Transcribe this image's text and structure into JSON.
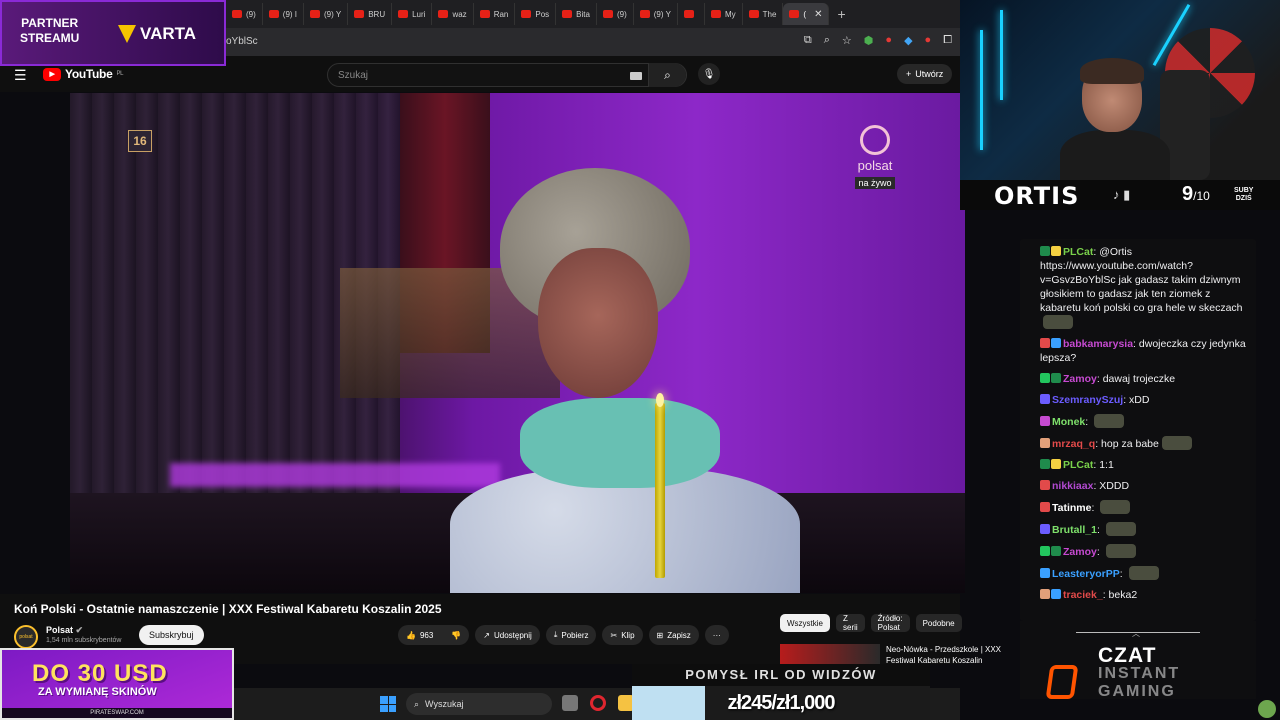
{
  "browser": {
    "tabs": [
      {
        "label": "(9)"
      },
      {
        "label": "(9) I"
      },
      {
        "label": "(9) Y"
      },
      {
        "label": "BRU"
      },
      {
        "label": "Luri"
      },
      {
        "label": "waz"
      },
      {
        "label": "Ran"
      },
      {
        "label": "Pos"
      },
      {
        "label": "Bita"
      },
      {
        "label": "(9)"
      },
      {
        "label": "(9) Y"
      },
      {
        "label": ""
      },
      {
        "label": "My"
      },
      {
        "label": "The"
      },
      {
        "label": "("
      }
    ],
    "url": "oYblSc"
  },
  "youtube": {
    "logo_text": "YouTube",
    "region": "PL",
    "search_placeholder": "Szukaj",
    "create_label": "Utwórz"
  },
  "video": {
    "age_rating": "16",
    "channel_logo": "polsat",
    "live_label": "na żywo",
    "title": "Koń Polski - Ostatnie namaszczenie | XXX Festiwal Kabaretu Koszalin 2025",
    "channel": "Polsat",
    "channel_avatar_text": "polsat",
    "subscribers": "1,54 mln subskrybentów",
    "subscribe_label": "Subskrybuj",
    "likes": "963",
    "share_label": "Udostępnij",
    "download_label": "Pobierz",
    "clip_label": "Klip",
    "save_label": "Zapisz",
    "more_label": "···"
  },
  "sidebar": {
    "chips": [
      "Wszystkie",
      "Z serii",
      "Źródło: Polsat",
      "Podobne"
    ],
    "rec_title": "Neo-Nówka - Przedszkole | XXX Festiwal Kabaretu Koszalin"
  },
  "overlays": {
    "partner_label": "PARTNER\nSTREAMU",
    "sponsor": "VARTA",
    "promo_big": "DO 30 USD",
    "promo_small": "ZA WYMIANĘ SKINÓW",
    "promo_site": "PIRATESWAP.COM",
    "streamer_name": "ORTIS",
    "subs_today": "9",
    "subs_goal": "/10",
    "subs_label": "SUBY\nDZIŚ",
    "pomysl": "POMYSŁ IRL OD WIDZÓW",
    "donation_goal": "zł245/zł1,000",
    "donation_progress": 0.245,
    "czat": "CZAT",
    "instant_gaming": "INSTANT\nGAMING"
  },
  "taskbar": {
    "search_label": "Wyszukaj"
  },
  "chat": [
    {
      "user": "PLCat",
      "color": "#7ad14b",
      "badges": [
        "#1f8b4c",
        "#f5d142"
      ],
      "text": "@Ortis https://www.youtube.com/watch?v=GsvzBoYblSc jak gadasz takim dziwnym głosikiem to gadasz jak ten ziomek z kabaretu koń polski co gra hele w skeczach",
      "emote": true
    },
    {
      "user": "babkamarysia",
      "color": "#c64ad1",
      "badges": [
        "#e24a4a",
        "#3aa0ff"
      ],
      "text": "dwojeczka czy jedynka lepsza?",
      "emote": false
    },
    {
      "user": "Zamoy",
      "color": "#c64ad1",
      "badges": [
        "#22c55e",
        "#1f8b4c"
      ],
      "text": "dawaj trojeczke",
      "emote": false
    },
    {
      "user": "SzemranySzuj",
      "color": "#6b5cff",
      "badges": [
        "#6b5cff"
      ],
      "text": "xDD",
      "emote": false
    },
    {
      "user": "Monek",
      "color": "#7ee06b",
      "badges": [
        "#c64ad1"
      ],
      "text": "",
      "emote": true
    },
    {
      "user": "mrzaq_q",
      "color": "#e24a4a",
      "badges": [
        "#e2a07a"
      ],
      "text": "hop za babe",
      "emote": true
    },
    {
      "user": "PLCat",
      "color": "#7ad14b",
      "badges": [
        "#1f8b4c",
        "#f5d142"
      ],
      "text": "1:1",
      "emote": false
    },
    {
      "user": "nikkiaax",
      "color": "#b24ad1",
      "badges": [
        "#e24a4a"
      ],
      "text": "XDDD",
      "emote": false
    },
    {
      "user": "Tatinme",
      "color": "#ffffff",
      "badges": [
        "#e24a4a"
      ],
      "text": "",
      "emote": true
    },
    {
      "user": "Brutall_1",
      "color": "#7ee06b",
      "badges": [
        "#6b5cff"
      ],
      "text": "",
      "emote": true
    },
    {
      "user": "Zamoy",
      "color": "#c64ad1",
      "badges": [
        "#22c55e",
        "#1f8b4c"
      ],
      "text": "",
      "emote": true
    },
    {
      "user": "LeasteryorPP",
      "color": "#3aa0ff",
      "badges": [
        "#3aa0ff"
      ],
      "text": "",
      "emote": true
    },
    {
      "user": "traciek_",
      "color": "#e24a4a",
      "badges": [
        "#e2a07a",
        "#3aa0ff"
      ],
      "text": "beka2",
      "emote": false
    }
  ]
}
